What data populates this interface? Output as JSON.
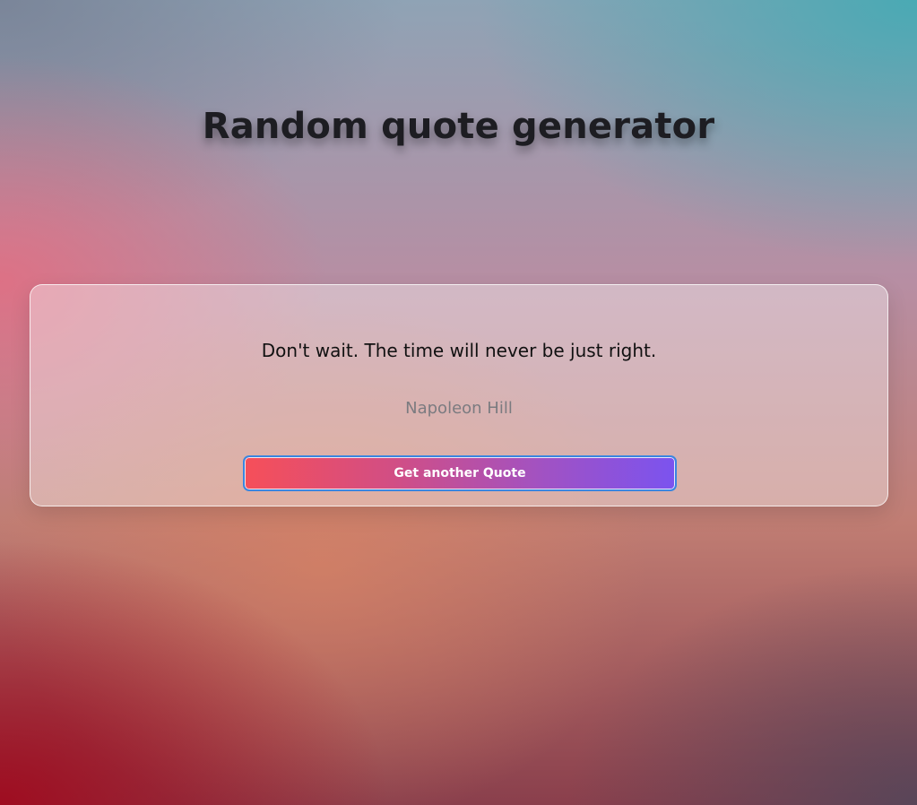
{
  "header": {
    "title": "Random quote generator"
  },
  "quote": {
    "text": "Don't wait. The time will never be just right.",
    "author": "Napoleon Hill"
  },
  "actions": {
    "new_quote_label": "Get another Quote"
  },
  "colors": {
    "button_gradient_start": "#f64f59",
    "button_gradient_end": "#7b53ef",
    "button_focus_ring": "#3a86e0",
    "title_text": "#1d1d22",
    "author_text": "#7b7b80"
  }
}
